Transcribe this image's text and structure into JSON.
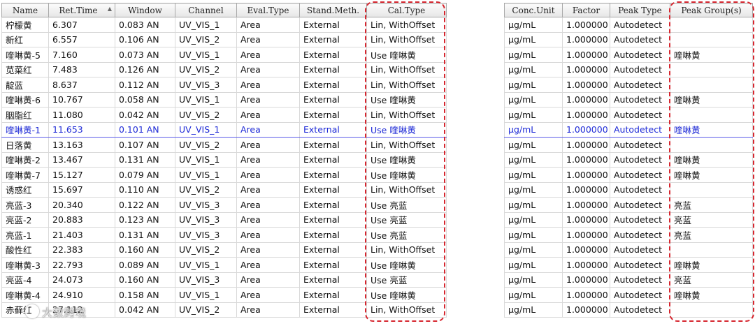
{
  "left_table": {
    "columns": [
      "Name",
      "Ret.Time",
      "Window",
      "Channel",
      "Eval.Type",
      "Stand.Meth.",
      "Cal.Type"
    ],
    "sort_indicator": "▲",
    "rows": [
      [
        "柠檬黄",
        "6.307",
        "0.083 AN",
        "UV_VIS_1",
        "Area",
        "External",
        "Lin, WithOffset"
      ],
      [
        "新红",
        "6.557",
        "0.106 AN",
        "UV_VIS_2",
        "Area",
        "External",
        "Lin, WithOffset"
      ],
      [
        "喹啉黄-5",
        "7.160",
        "0.073 AN",
        "UV_VIS_1",
        "Area",
        "External",
        "Use 喹啉黄"
      ],
      [
        "苋菜红",
        "7.483",
        "0.126 AN",
        "UV_VIS_2",
        "Area",
        "External",
        "Lin, WithOffset"
      ],
      [
        "靛蓝",
        "8.637",
        "0.112 AN",
        "UV_VIS_3",
        "Area",
        "External",
        "Lin, WithOffset"
      ],
      [
        "喹啉黄-6",
        "10.767",
        "0.058 AN",
        "UV_VIS_1",
        "Area",
        "External",
        "Use 喹啉黄"
      ],
      [
        "胭脂红",
        "11.080",
        "0.042 AN",
        "UV_VIS_2",
        "Area",
        "External",
        "Lin, WithOffset"
      ],
      [
        "喹啉黄-1",
        "11.653",
        "0.101 AN",
        "UV_VIS_1",
        "Area",
        "External",
        "Use 喹啉黄"
      ],
      [
        "日落黄",
        "13.163",
        "0.107 AN",
        "UV_VIS_2",
        "Area",
        "External",
        "Lin, WithOffset"
      ],
      [
        "喹啉黄-2",
        "13.467",
        "0.131 AN",
        "UV_VIS_1",
        "Area",
        "External",
        "Use 喹啉黄"
      ],
      [
        "喹啉黄-7",
        "15.127",
        "0.079 AN",
        "UV_VIS_1",
        "Area",
        "External",
        "Use 喹啉黄"
      ],
      [
        "诱惑红",
        "15.697",
        "0.110 AN",
        "UV_VIS_2",
        "Area",
        "External",
        "Lin, WithOffset"
      ],
      [
        "亮蓝-3",
        "20.340",
        "0.122 AN",
        "UV_VIS_3",
        "Area",
        "External",
        "Use 亮蓝"
      ],
      [
        "亮蓝-2",
        "20.883",
        "0.123 AN",
        "UV_VIS_3",
        "Area",
        "External",
        "Use 亮蓝"
      ],
      [
        "亮蓝-1",
        "21.403",
        "0.131 AN",
        "UV_VIS_3",
        "Area",
        "External",
        "Use 亮蓝"
      ],
      [
        "酸性红",
        "22.383",
        "0.160 AN",
        "UV_VIS_2",
        "Area",
        "External",
        "Lin, WithOffset"
      ],
      [
        "喹啉黄-3",
        "22.793",
        "0.089 AN",
        "UV_VIS_1",
        "Area",
        "External",
        "Use 喹啉黄"
      ],
      [
        "亮蓝-4",
        "24.073",
        "0.160 AN",
        "UV_VIS_3",
        "Area",
        "External",
        "Use 亮蓝"
      ],
      [
        "喹啉黄-4",
        "24.910",
        "0.158 AN",
        "UV_VIS_1",
        "Area",
        "External",
        "Use 喹啉黄"
      ],
      [
        "赤藓红",
        "27.112",
        "0.042 AN",
        "UV_VIS_2",
        "Area",
        "External",
        "Lin, WithOffset"
      ]
    ]
  },
  "right_table": {
    "columns": [
      "Conc.Unit",
      "Factor",
      "Peak Type",
      "Peak Group(s)"
    ],
    "rows": [
      [
        "µg/mL",
        "1.000000",
        "Autodetect",
        ""
      ],
      [
        "µg/mL",
        "1.000000",
        "Autodetect",
        ""
      ],
      [
        "µg/mL",
        "1.000000",
        "Autodetect",
        "喹啉黄"
      ],
      [
        "µg/mL",
        "1.000000",
        "Autodetect",
        ""
      ],
      [
        "µg/mL",
        "1.000000",
        "Autodetect",
        ""
      ],
      [
        "µg/mL",
        "1.000000",
        "Autodetect",
        "喹啉黄"
      ],
      [
        "µg/mL",
        "1.000000",
        "Autodetect",
        ""
      ],
      [
        "µg/mL",
        "1.000000",
        "Autodetect",
        "喹啉黄"
      ],
      [
        "µg/mL",
        "1.000000",
        "Autodetect",
        ""
      ],
      [
        "µg/mL",
        "1.000000",
        "Autodetect",
        "喹啉黄"
      ],
      [
        "µg/mL",
        "1.000000",
        "Autodetect",
        "喹啉黄"
      ],
      [
        "µg/mL",
        "1.000000",
        "Autodetect",
        ""
      ],
      [
        "µg/mL",
        "1.000000",
        "Autodetect",
        "亮蓝"
      ],
      [
        "µg/mL",
        "1.000000",
        "Autodetect",
        "亮蓝"
      ],
      [
        "µg/mL",
        "1.000000",
        "Autodetect",
        "亮蓝"
      ],
      [
        "µg/mL",
        "1.000000",
        "Autodetect",
        ""
      ],
      [
        "µg/mL",
        "1.000000",
        "Autodetect",
        "喹啉黄"
      ],
      [
        "µg/mL",
        "1.000000",
        "Autodetect",
        "亮蓝"
      ],
      [
        "µg/mL",
        "1.000000",
        "Autodetect",
        "喹啉黄"
      ],
      [
        "µg/mL",
        "1.000000",
        "Autodetect",
        ""
      ]
    ]
  },
  "selected_row": 7,
  "colors": {
    "selection_text": "#1f2bd6",
    "highlight_border": "#d6262f"
  },
  "watermark": {
    "icon": "watermark-logo-icon",
    "text": "大数跨境"
  }
}
